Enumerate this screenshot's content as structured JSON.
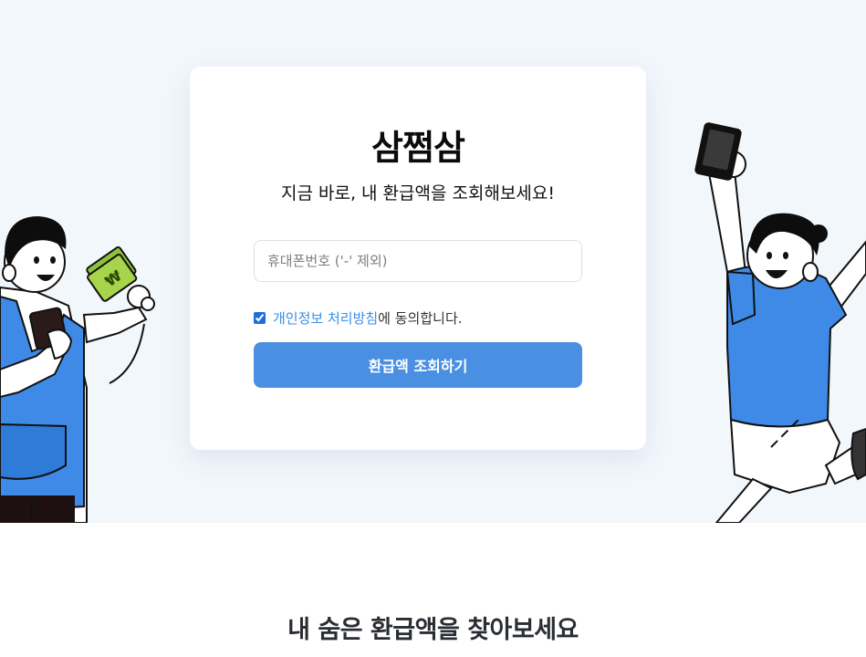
{
  "hero": {
    "brand": "삼쩜삼",
    "subtitle": "지금 바로, 내 환급액을 조회해보세요!",
    "phone_input": {
      "placeholder": "휴대폰번호 ('-' 제외)",
      "value": ""
    },
    "consent": {
      "checked": true,
      "link_text": "개인정보 처리방침",
      "suffix_text": "에 동의합니다."
    },
    "submit_label": "환급액 조회하기"
  },
  "section": {
    "title": "내 숨은 환급액을 찾아보세요"
  },
  "colors": {
    "hero_background": "#f2f7fc",
    "primary_button": "#4a90e2",
    "link": "#3a8ee6",
    "illustration_blue": "#3f8ae6",
    "money_green": "#a6d44a"
  },
  "icons": {
    "left_illustration": "person-holding-money-illustration",
    "right_illustration": "person-cheering-with-phone-illustration"
  }
}
